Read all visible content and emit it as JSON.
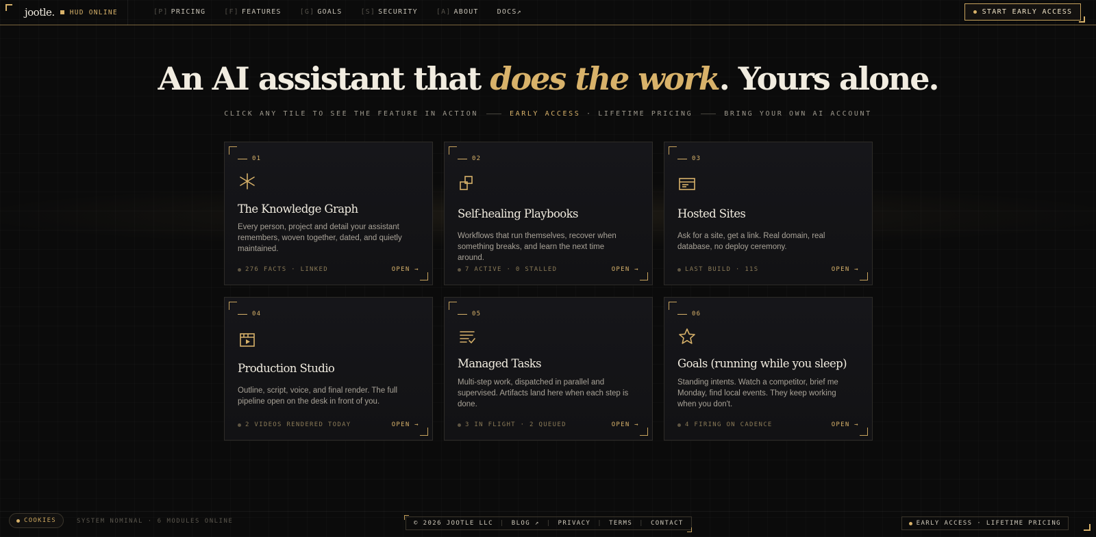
{
  "brand": {
    "logo": "jootle.",
    "status": "HUD ONLINE"
  },
  "nav": {
    "links": [
      {
        "key": "[P]",
        "label": "PRICING"
      },
      {
        "key": "[F]",
        "label": "FEATURES"
      },
      {
        "key": "[G]",
        "label": "GOALS"
      },
      {
        "key": "[S]",
        "label": "SECURITY"
      },
      {
        "key": "[A]",
        "label": "ABOUT"
      },
      {
        "key": "",
        "label": "DOCS↗"
      }
    ],
    "cta": "START EARLY ACCESS"
  },
  "hero": {
    "title_pre": "An AI assistant that ",
    "title_em": "does the work",
    "title_post": ". Yours alone.",
    "sub_1": "CLICK ANY TILE TO SEE THE FEATURE IN ACTION",
    "sub_2": "EARLY ACCESS",
    "sub_3": " · LIFETIME PRICING",
    "sub_4": "BRING YOUR OWN AI ACCOUNT"
  },
  "cards": [
    {
      "num": "01",
      "icon": "asterisk-icon",
      "title": "The Knowledge Graph",
      "desc": "Every person, project and detail your assistant remembers, woven together, dated, and quietly maintained.",
      "status": "276 FACTS · LINKED",
      "open": "OPEN →"
    },
    {
      "num": "02",
      "icon": "copy-squares-icon",
      "title": "Self-healing Playbooks",
      "desc": "Workflows that run themselves, recover when something breaks, and learn the next time around.",
      "status": "7 ACTIVE · 0 STALLED",
      "open": "OPEN →"
    },
    {
      "num": "03",
      "icon": "browser-window-icon",
      "title": "Hosted Sites",
      "desc": "Ask for a site, get a link. Real domain, real database, no deploy ceremony.",
      "status": "LAST BUILD · 11S",
      "open": "OPEN →"
    },
    {
      "num": "04",
      "icon": "video-player-icon",
      "title": "Production Studio",
      "desc": "Outline, script, voice, and final render. The full pipeline open on the desk in front of you.",
      "status": "2 VIDEOS RENDERED TODAY",
      "open": "OPEN →"
    },
    {
      "num": "05",
      "icon": "checklist-icon",
      "title": "Managed Tasks",
      "desc": "Multi-step work, dispatched in parallel and supervised. Artifacts land here when each step is done.",
      "status": "3 IN FLIGHT · 2 QUEUED",
      "open": "OPEN →"
    },
    {
      "num": "06",
      "icon": "star-icon",
      "title": "Goals (running while you sleep)",
      "desc": "Standing intents. Watch a competitor, brief me Monday, find local events. They keep working when you don't.",
      "status": "4 FIRING ON CADENCE",
      "open": "OPEN →"
    }
  ],
  "footer": {
    "cookies": "COOKIES",
    "system": "SYSTEM NOMINAL · 6 MODULES ONLINE",
    "copyright": "© 2026 JOOTLE LLC",
    "links": [
      "BLOG ↗",
      "PRIVACY",
      "TERMS",
      "CONTACT"
    ],
    "badge": "EARLY ACCESS · LIFETIME PRICING"
  },
  "colors": {
    "accent": "#d8b26a",
    "background": "#0b0b0b",
    "card": "#141416",
    "text": "#f1ece0"
  }
}
